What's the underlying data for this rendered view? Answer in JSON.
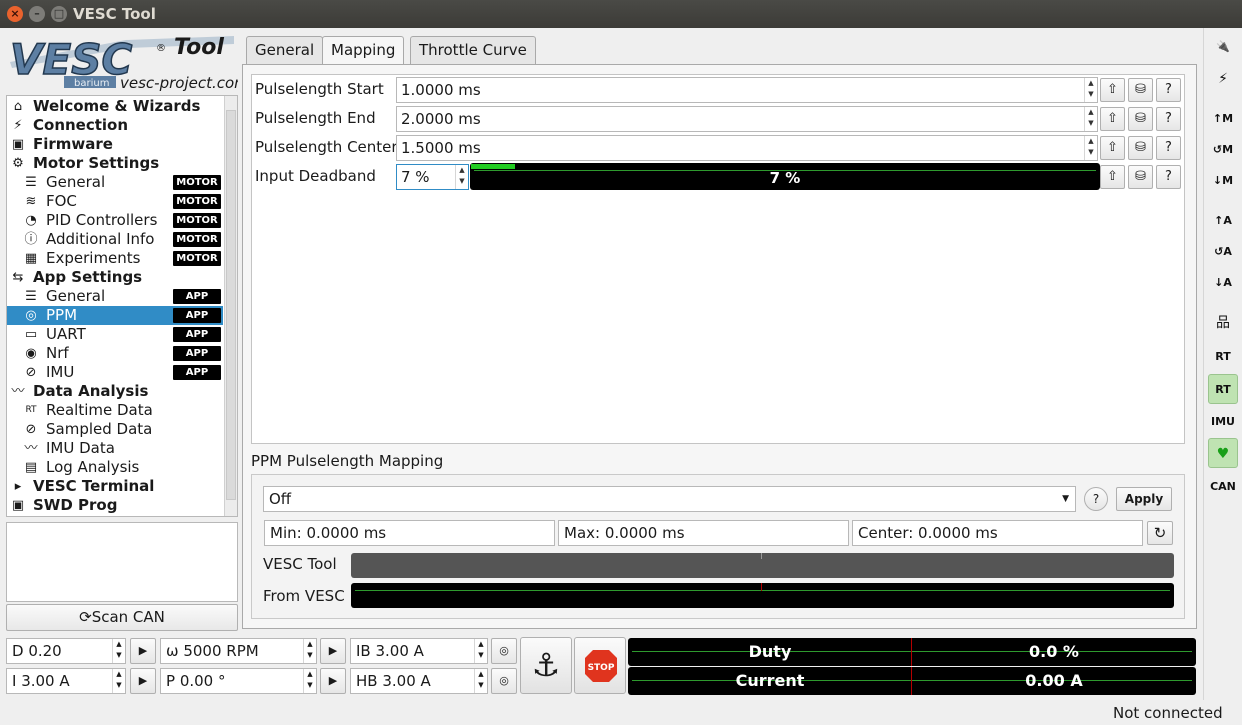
{
  "window": {
    "title": "VESC Tool",
    "close": "×",
    "minimize": "–",
    "maximize": "□"
  },
  "logo": {
    "wordmark": "VESC",
    "tool": "Tool",
    "reg": "®",
    "sub": "barium",
    "url": "vesc-project.com"
  },
  "tree": {
    "items": [
      {
        "label": "Welcome & Wizards",
        "icon": "home-icon",
        "glyph": "⌂",
        "level": 0
      },
      {
        "label": "Connection",
        "icon": "plug-icon",
        "glyph": "⚡",
        "level": 0
      },
      {
        "label": "Firmware",
        "icon": "chip-icon",
        "glyph": "▣",
        "level": 0
      },
      {
        "label": "Motor Settings",
        "icon": "motor-icon",
        "glyph": "⚙",
        "level": 0
      },
      {
        "label": "General",
        "icon": "sliders-icon",
        "glyph": "☰",
        "level": 1,
        "badge": "MOTOR"
      },
      {
        "label": "FOC",
        "icon": "foc-icon",
        "glyph": "≋",
        "level": 1,
        "badge": "MOTOR"
      },
      {
        "label": "PID Controllers",
        "icon": "gauge-icon",
        "glyph": "◔",
        "level": 1,
        "badge": "MOTOR"
      },
      {
        "label": "Additional Info",
        "icon": "info-icon",
        "glyph": "ⓘ",
        "level": 1,
        "badge": "MOTOR"
      },
      {
        "label": "Experiments",
        "icon": "calculator-icon",
        "glyph": "▦",
        "level": 1,
        "badge": "MOTOR"
      },
      {
        "label": "App Settings",
        "icon": "app-icon",
        "glyph": "⇆",
        "level": 0
      },
      {
        "label": "General",
        "icon": "sliders-icon",
        "glyph": "☰",
        "level": 1,
        "badge": "APP"
      },
      {
        "label": "PPM",
        "icon": "gamepad-icon",
        "glyph": "◎",
        "level": 1,
        "badge": "APP",
        "selected": true
      },
      {
        "label": "UART",
        "icon": "keyboard-icon",
        "glyph": "▭",
        "level": 1,
        "badge": "APP"
      },
      {
        "label": "Nrf",
        "icon": "wireless-icon",
        "glyph": "◉",
        "level": 1,
        "badge": "APP"
      },
      {
        "label": "IMU",
        "icon": "imu-icon",
        "glyph": "⊘",
        "level": 1,
        "badge": "APP"
      },
      {
        "label": "Data Analysis",
        "icon": "chart-icon",
        "glyph": "〰",
        "level": 0
      },
      {
        "label": "Realtime Data",
        "icon": "rt-icon",
        "glyph": "RT",
        "level": 1
      },
      {
        "label": "Sampled Data",
        "icon": "sampled-icon",
        "glyph": "⊘",
        "level": 1
      },
      {
        "label": "IMU Data",
        "icon": "imu-data-icon",
        "glyph": "〰",
        "level": 1
      },
      {
        "label": "Log Analysis",
        "icon": "map-icon",
        "glyph": "▤",
        "level": 1
      },
      {
        "label": "VESC Terminal",
        "icon": "terminal-icon",
        "glyph": "▸",
        "level": 0
      },
      {
        "label": "SWD Prog",
        "icon": "swd-icon",
        "glyph": "▣",
        "level": 0
      }
    ]
  },
  "scan_can": {
    "label": "Scan CAN",
    "glyph": "⟳"
  },
  "tabs": [
    "General",
    "Mapping",
    "Throttle Curve"
  ],
  "active_tab": "Mapping",
  "params": [
    {
      "label": "Pulselength Start",
      "value": "1.0000 ms"
    },
    {
      "label": "Pulselength End",
      "value": "2.0000 ms"
    },
    {
      "label": "Pulselength Center",
      "value": "1.5000 ms"
    },
    {
      "label": "Input Deadband",
      "value": "7 %",
      "bar_text": "7 %",
      "bar_fraction": 0.07
    }
  ],
  "param_buttons": {
    "upload": "⇧",
    "restore": "⛁",
    "help": "?"
  },
  "mapping": {
    "title": "PPM Pulselength Mapping",
    "mode": "Off",
    "apply": "Apply",
    "help": "?",
    "min": "Min: 0.0000 ms",
    "max": "Max: 0.0000 ms",
    "center": "Center: 0.0000 ms",
    "reset": "↻",
    "vesc_tool_label": "VESC Tool",
    "from_vesc_label": "From VESC"
  },
  "right_toolbar": [
    {
      "name": "connect-icon",
      "glyph": "🔌"
    },
    {
      "name": "disconnect-icon",
      "glyph": "⚡"
    },
    {
      "name": "read-motor-config-icon",
      "glyph": "↑M"
    },
    {
      "name": "read-default-motor-config-icon",
      "glyph": "↺M"
    },
    {
      "name": "write-motor-config-icon",
      "glyph": "↓M"
    },
    {
      "name": "read-app-config-icon",
      "glyph": "↑A"
    },
    {
      "name": "read-default-app-config-icon",
      "glyph": "↺A"
    },
    {
      "name": "write-app-config-icon",
      "glyph": "↓A"
    },
    {
      "name": "can-fwd-icon",
      "glyph": "品"
    },
    {
      "name": "rt-data-icon",
      "glyph": "RT"
    },
    {
      "name": "rt-app-icon",
      "glyph": "RT",
      "active": true
    },
    {
      "name": "imu-stream-icon",
      "glyph": "IMU"
    },
    {
      "name": "heartbeat-icon",
      "glyph": "♥",
      "active": true
    },
    {
      "name": "can-icon",
      "glyph": "CAN"
    }
  ],
  "controls": {
    "duty": "D 0.20",
    "current": "I 3.00 A",
    "rpm": "ω 5000 RPM",
    "position": "P 0.00 °",
    "brake": "IB 3.00 A",
    "handbrake": "HB 3.00 A",
    "play": "▶",
    "brake_glyph": "◎",
    "anchor": "⚓",
    "stop": "STOP"
  },
  "gauges": {
    "duty_label": "Duty",
    "duty_value": "0.0 %",
    "current_label": "Current",
    "current_value": "0.00 A"
  },
  "status": "Not connected",
  "colors": {
    "selection": "#308cc6",
    "green": "#22cc22",
    "stop_red": "#e0341e"
  }
}
